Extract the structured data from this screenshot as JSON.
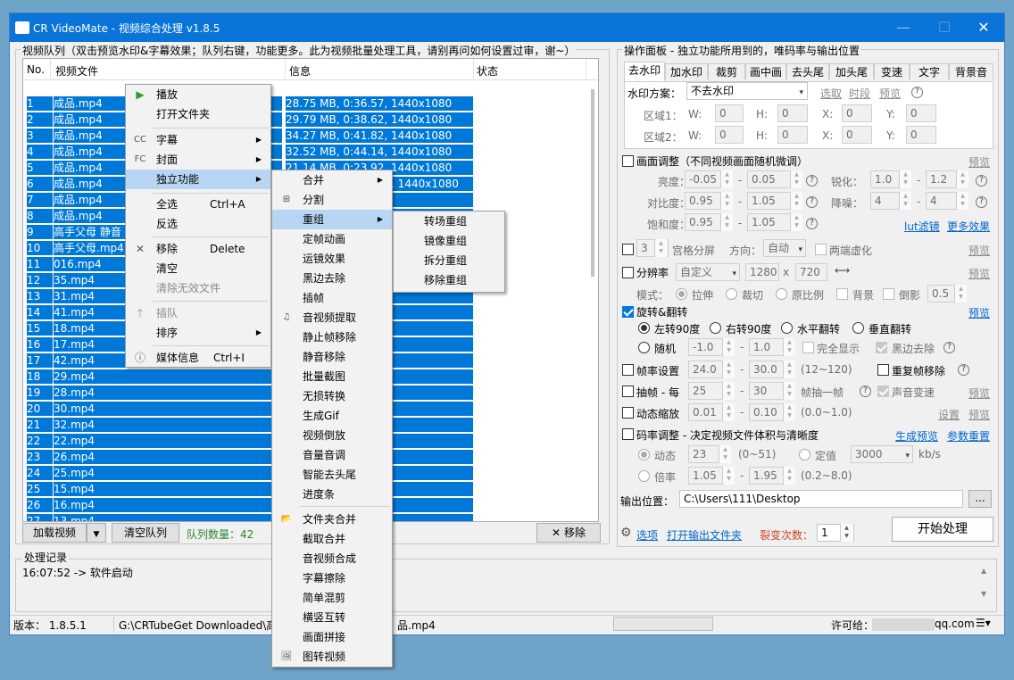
{
  "window": {
    "title": "CR VideoMate - 视频综合处理 v1.8.5",
    "min": "—",
    "max": "☐",
    "close": "✕"
  },
  "queue": {
    "group_title": "视频队列（双击预览水印&字幕效果；队列右键，功能更多。此为视频批量处理工具，请别再问如何设置过审，谢~）",
    "col_no": "No.",
    "col_file": "视频文件",
    "col_info": "信息",
    "col_status": "状态",
    "rows": [
      {
        "no": "1",
        "file": "成品.mp4",
        "info": "28.75 MB, 0:36.57, 1440x1080"
      },
      {
        "no": "2",
        "file": "成品.mp4",
        "info": "29.79 MB, 0:38.62, 1440x1080"
      },
      {
        "no": "3",
        "file": "成品.mp4",
        "info": "34.27 MB, 0:41.82, 1440x1080"
      },
      {
        "no": "4",
        "file": "成品.mp4",
        "info": "32.52 MB, 0:44.14, 1440x1080"
      },
      {
        "no": "5",
        "file": "成品.mp4",
        "info": "21.14 MB, 0:23.92, 1440x1080"
      },
      {
        "no": "6",
        "file": "成品.mp4",
        "info": "66.36 MB, 01:14.07, 1440x1080"
      },
      {
        "no": "7",
        "file": "成品.mp4",
        "info": ", 1440x1080"
      },
      {
        "no": "8",
        "file": "成品.mp4",
        "info": ", 1440x1080"
      },
      {
        "no": "9",
        "file": "高手父母 静音",
        "info": ", 1440x1080"
      },
      {
        "no": "10",
        "file": "高手父母.mp4",
        "info": ", 1440x1080"
      },
      {
        "no": "11",
        "file": "016.mp4",
        "info": ", 1440x1080"
      },
      {
        "no": "12",
        "file": "35.mp4",
        "info": ", 1440x1080"
      },
      {
        "no": "13",
        "file": "31.mp4",
        "info": ", 1440x1080"
      },
      {
        "no": "14",
        "file": "41.mp4",
        "info": "80x1920"
      },
      {
        "no": "15",
        "file": "18.mp4",
        "info": "80x1920"
      },
      {
        "no": "16",
        "file": "17.mp4",
        "info": "80x1920"
      },
      {
        "no": "17",
        "file": "42.mp4",
        "info": "080x1920"
      },
      {
        "no": "18",
        "file": "29.mp4",
        "info": "080x1920"
      },
      {
        "no": "19",
        "file": "28.mp4",
        "info": "20x1080"
      },
      {
        "no": "20",
        "file": "30.mp4",
        "info": "80x1920"
      },
      {
        "no": "21",
        "file": "32.mp4",
        "info": "080x1440"
      },
      {
        "no": "22",
        "file": "22.mp4",
        "info": "20x1080"
      },
      {
        "no": "23",
        "file": "26.mp4",
        "info": "80x1920"
      },
      {
        "no": "24",
        "file": "25.mp4",
        "info": "80x1920"
      },
      {
        "no": "25",
        "file": "15.mp4",
        "info": "1080x1920"
      },
      {
        "no": "26",
        "file": "16.mp4",
        "info": "20x1080"
      },
      {
        "no": "27",
        "file": "13.mp4",
        "info": "80x1920"
      }
    ],
    "load_btn": "加载视频",
    "clear_btn": "清空队列",
    "count_label": "队列数量：42",
    "remove_btn": "移除"
  },
  "log": {
    "title": "处理记录",
    "line": "16:07:52 -> 软件启动"
  },
  "statusbar": {
    "version": "版本：  1.8.5.1",
    "path": "G:\\CRTubeGet Downloaded\\高",
    "path_end": "品.mp4",
    "license": "许可给：",
    "email": "qq.com"
  },
  "context_menu": {
    "items": [
      "播放",
      "打开文件夹",
      "字幕",
      "封面",
      "独立功能",
      "全选",
      "反选",
      "移除",
      "清空",
      "清除无效文件",
      "插队",
      "排序",
      "媒体信息"
    ],
    "shortcuts": {
      "select_all": "Ctrl+A",
      "remove": "Delete",
      "media_info": "Ctrl+I"
    },
    "icons": {
      "subtitle": "CC",
      "cover": "FC"
    }
  },
  "submenu": {
    "items": [
      "合并",
      "分割",
      "重组",
      "定帧动画",
      "运镜效果",
      "黑边去除",
      "插帧",
      "音视频提取",
      "静止帧移除",
      "静音移除",
      "批量截图",
      "无损转换",
      "生成Gif",
      "视频倒放",
      "音量音调",
      "智能去头尾",
      "进度条",
      "文件夹合并",
      "截取合并",
      "音视频合成",
      "字幕擦除",
      "简单混剪",
      "横竖互转",
      "画面拼接",
      "图转视频"
    ]
  },
  "submenu2": {
    "items": [
      "转场重组",
      "镜像重组",
      "拆分重组",
      "移除重组"
    ]
  },
  "panel": {
    "title": "操作面板 - 独立功能所用到的，唯码率与输出位置",
    "tabs": [
      "去水印",
      "加水印",
      "裁剪",
      "画中画",
      "去头尾",
      "加头尾",
      "变速",
      "文字",
      "背景音"
    ],
    "wm_label": "水印方案：",
    "wm_value": "不去水印",
    "wm_links": [
      "选取",
      "时段",
      "预览"
    ],
    "area1": "区域1：",
    "area2": "区域2：",
    "w": "W:",
    "h": "H:",
    "x": "X:",
    "y": "Y:",
    "zero": "0",
    "adjust": "画面调整（不同视频画面随机微调）",
    "preview": "预览",
    "brightness": "亮度：",
    "contrast": "对比度：",
    "saturation": "饱和度：",
    "sharpen": "锐化：",
    "denoise": "降噪：",
    "b1": "-0.05",
    "b2": "0.05",
    "c1": "0.95",
    "c2": "1.05",
    "s1": "0.95",
    "s2": "1.05",
    "sh1": "1.0",
    "sh2": "1.2",
    "dn1": "4",
    "dn2": "4",
    "lut": "lut滤镜",
    "more": "更多效果",
    "grid_num": "3",
    "grid_label": "宫格分屏",
    "direction": "方向：",
    "dir_value": "自动",
    "blur": "两端虚化",
    "res_label": "分辨率",
    "res_mode": "自定义",
    "res_w": "1280",
    "res_x": "x",
    "res_h": "720",
    "swap": "⟷",
    "mode": "模式：",
    "stretch": "拉伸",
    "crop": "裁切",
    "ratio": "原比例",
    "bg": "背景",
    "tilt": "倒影",
    "tilt_val": "0.5",
    "rotate": "旋转&翻转",
    "rot_left": "左转90度",
    "rot_right": "右转90度",
    "hflip": "水平翻转",
    "vflip": "垂直翻转",
    "random": "随机",
    "r1": "-1.0",
    "r2": "1.0",
    "full": "完全显示",
    "black": "黑边去除",
    "fps": "帧率设置",
    "fps1": "24.0",
    "fps2": "30.0",
    "fps_range": "(12~120)",
    "dup": "重复帧移除",
    "drop": "抽帧 - 每",
    "drop1": "25",
    "drop2": "30",
    "drop_unit": "帧抽一帧",
    "pitch": "声音变速",
    "zoom": "动态缩放",
    "z1": "0.01",
    "z2": "0.10",
    "z_range": "(0.0~1.0)",
    "settings": "设置",
    "bitrate": "码率调整 - 决定视频文件体积与清晰度",
    "gen_preview": "生成预览",
    "reset": "参数重置",
    "dynamic": "动态",
    "dyn_val": "23",
    "dyn_range": "(0~51)",
    "fixed": "定值",
    "fixed_val": "3000",
    "kbs": "kb/s",
    "mult": "倍率",
    "m1": "1.05",
    "m2": "1.95",
    "m_range": "(0.2~8.0)",
    "dash": "-",
    "out_label": "输出位置：",
    "out_path": "C:\\Users\\111\\Desktop",
    "browse": "...",
    "options": "选项",
    "open_out": "打开输出文件夹",
    "fission": "裂变次数：",
    "fission_val": "1",
    "start": "开始处理"
  },
  "colors": {
    "select": "#0078d7",
    "title": "#0a74d8",
    "link": "#0066cc"
  }
}
